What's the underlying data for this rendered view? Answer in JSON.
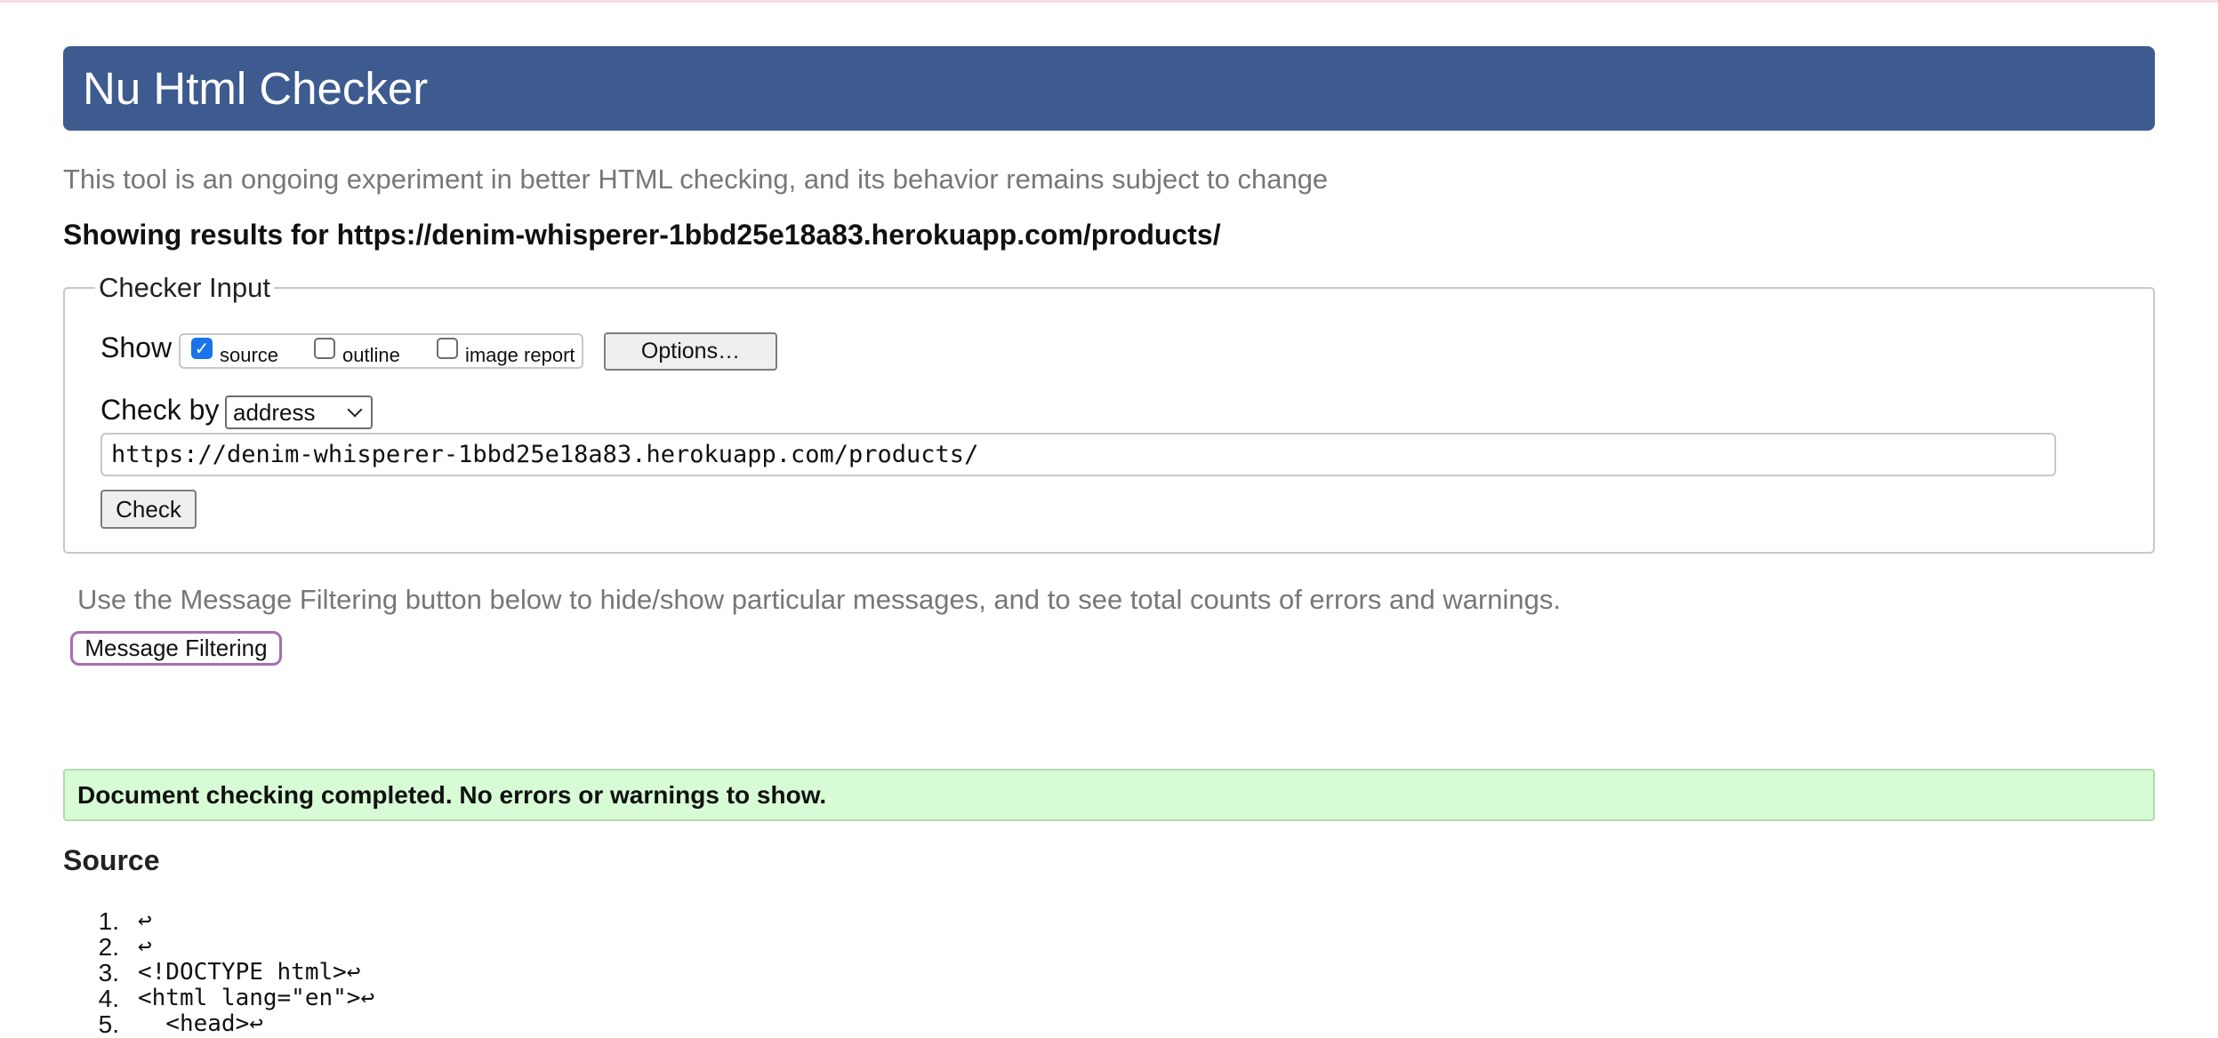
{
  "page": {
    "title": "Nu Html Checker",
    "tagline": "This tool is an ongoing experiment in better HTML checking, and its behavior remains subject to change",
    "results_heading": "Showing results for https://denim-whisperer-1bbd25e18a83.herokuapp.com/products/"
  },
  "checker_input": {
    "legend": "Checker Input",
    "show_label": "Show",
    "show_options": [
      {
        "label": "source",
        "checked": true
      },
      {
        "label": "outline",
        "checked": false
      },
      {
        "label": "image report",
        "checked": false
      }
    ],
    "options_button": "Options…",
    "check_by_label": "Check by",
    "check_by_value": "address",
    "url_value": "https://denim-whisperer-1bbd25e18a83.herokuapp.com/products/",
    "check_button": "Check"
  },
  "filtering": {
    "hint": "Use the Message Filtering button below to hide/show particular messages, and to see total counts of errors and warnings.",
    "button": "Message Filtering"
  },
  "result": {
    "message": "Document checking completed. No errors or warnings to show."
  },
  "source": {
    "heading": "Source",
    "lines": [
      {
        "no": "1.",
        "code": "↩"
      },
      {
        "no": "2.",
        "code": "↩"
      },
      {
        "no": "3.",
        "code": "<!DOCTYPE html>↩"
      },
      {
        "no": "4.",
        "code": "<html lang=\"en\">↩"
      },
      {
        "no": "5.",
        "code": "  <head>↩"
      }
    ]
  },
  "colors": {
    "banner": "#3d5b8f",
    "success_bg": "#d7fbd4",
    "filter_border": "#a56fb0",
    "checkbox_checked": "#1a73e8"
  },
  "icons": {
    "checkbox_checked": "checkmark-icon",
    "select_arrow": "chevron-down-icon"
  }
}
